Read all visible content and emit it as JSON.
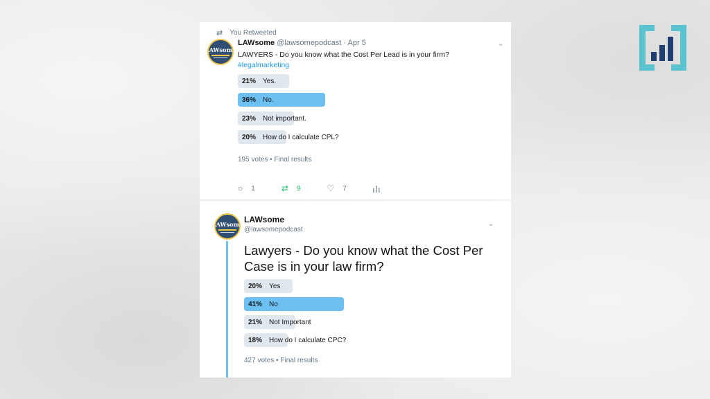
{
  "tweet1": {
    "retweet_label": "You Retweeted",
    "avatar_text": "LAWsome",
    "name": "LAWsome",
    "handle_date": "@lawsomepodcast · Apr 5",
    "text": "LAWYERS - Do you know what the Cost Per Lead is in your firm?",
    "hashtag": "#legalmarketing",
    "poll": [
      {
        "pct": "21%",
        "label": "Yes.",
        "value": 21,
        "winner": false
      },
      {
        "pct": "36%",
        "label": "No.",
        "value": 36,
        "winner": true
      },
      {
        "pct": "23%",
        "label": "Not important.",
        "value": 23,
        "winner": false
      },
      {
        "pct": "20%",
        "label": "How do I calculate CPL?",
        "value": 20,
        "winner": false
      }
    ],
    "meta": "195 votes • Final results",
    "replies": "1",
    "retweets": "9",
    "likes": "7"
  },
  "tweet2": {
    "avatar_text": "LAWsome",
    "name": "LAWsome",
    "handle": "@lawsomepodcast",
    "text": "Lawyers - Do you know what the Cost Per Case is in your law firm?",
    "poll": [
      {
        "pct": "20%",
        "label": "Yes",
        "value": 20,
        "winner": false
      },
      {
        "pct": "41%",
        "label": "No",
        "value": 41,
        "winner": true
      },
      {
        "pct": "21%",
        "label": "Not Important",
        "value": 21,
        "winner": false
      },
      {
        "pct": "18%",
        "label": "How do I calculate CPC?",
        "value": 18,
        "winner": false
      }
    ],
    "meta": "427 votes • Final results"
  },
  "colors": {
    "accent": "#1b95e0",
    "poll_winner": "#6cc0f2",
    "poll_other": "#e1e8ed",
    "retweet_green": "#17bf63",
    "logo_teal": "#5bc2cf",
    "logo_navy": "#1f3f73"
  },
  "icons": {
    "retweet": "retweet-icon",
    "reply": "reply-icon",
    "like": "heart-icon",
    "analytics": "analytics-icon",
    "menu": "chevron-down-icon",
    "brand": "bar-chart-logo-icon"
  }
}
